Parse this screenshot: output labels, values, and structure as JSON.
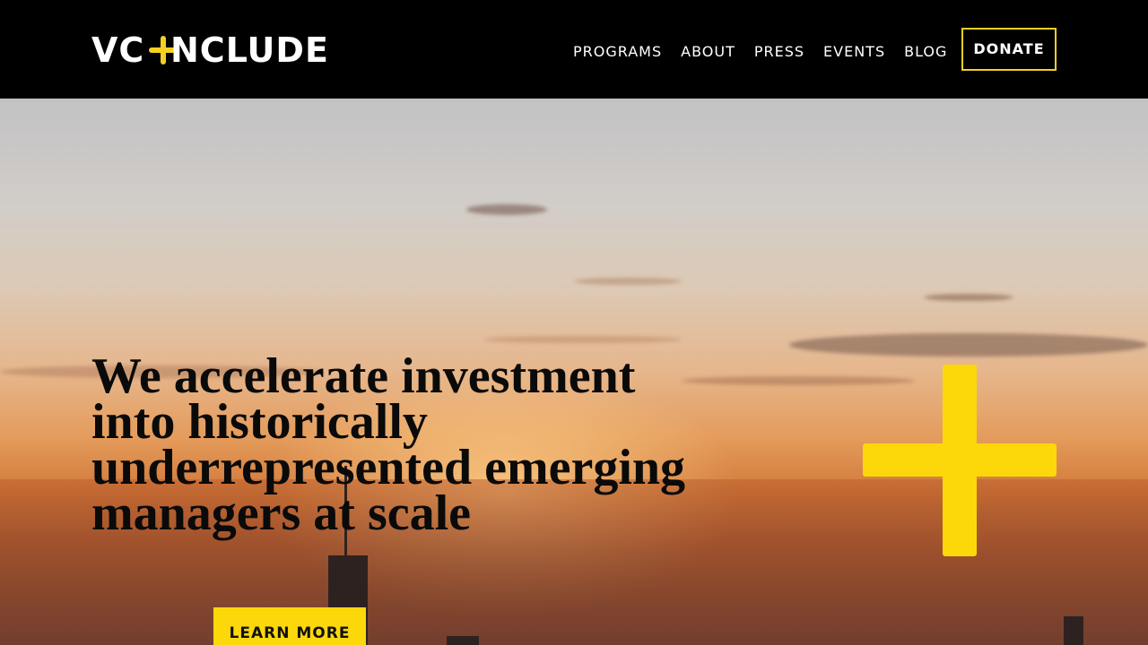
{
  "header": {
    "logo": {
      "left_text": "VC",
      "right_text": "NCLUDE",
      "plus_color": "#f5d021"
    },
    "nav": [
      {
        "label": "PROGRAMS"
      },
      {
        "label": "ABOUT"
      },
      {
        "label": "PRESS"
      },
      {
        "label": "EVENTS"
      },
      {
        "label": "BLOG"
      }
    ],
    "donate_label": "DONATE"
  },
  "hero": {
    "headline": "We accelerate investment into historically underrepresented emerging managers at scale",
    "cta_label": "LEARN MORE",
    "accent_color": "#fcd80a",
    "background": "sunset-skyline-photo"
  }
}
